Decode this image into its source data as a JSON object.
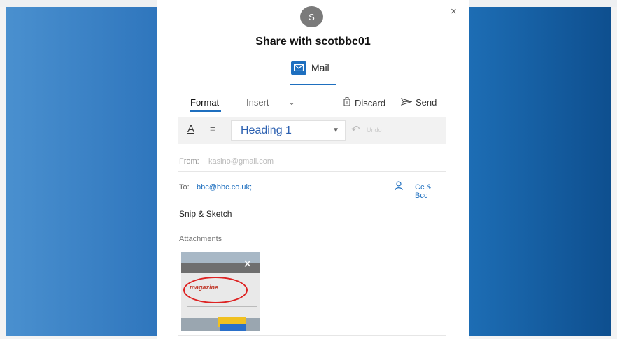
{
  "dialog": {
    "avatar_initial": "S",
    "close_glyph": "×",
    "title": "Share with scotbbc01",
    "app_label": "Mail",
    "accent_color": "#1e6fbf"
  },
  "tabs": {
    "format": "Format",
    "insert": "Insert",
    "more_glyph": "⌄"
  },
  "actions": {
    "discard": "Discard",
    "send": "Send"
  },
  "toolbar": {
    "font_glyph": "A",
    "paragraph_glyph": "≡",
    "style_value": "Heading 1",
    "undo_glyph": "↶",
    "undo_label": "Undo"
  },
  "compose": {
    "from_label": "From:",
    "from_value": "kasino@gmail.com",
    "to_label": "To:",
    "to_value": "bbc@bbc.co.uk;",
    "cc_bcc": "Cc & Bcc",
    "subject": "Snip & Sketch"
  },
  "attachments": {
    "label": "Attachments",
    "thumb_logo": "magazine",
    "remove_glyph": "×"
  },
  "icons": [
    "close-icon",
    "mail-icon",
    "trash-icon",
    "send-icon",
    "font-color-icon",
    "paragraph-icon",
    "chevron-down-icon",
    "undo-icon",
    "person-icon"
  ]
}
